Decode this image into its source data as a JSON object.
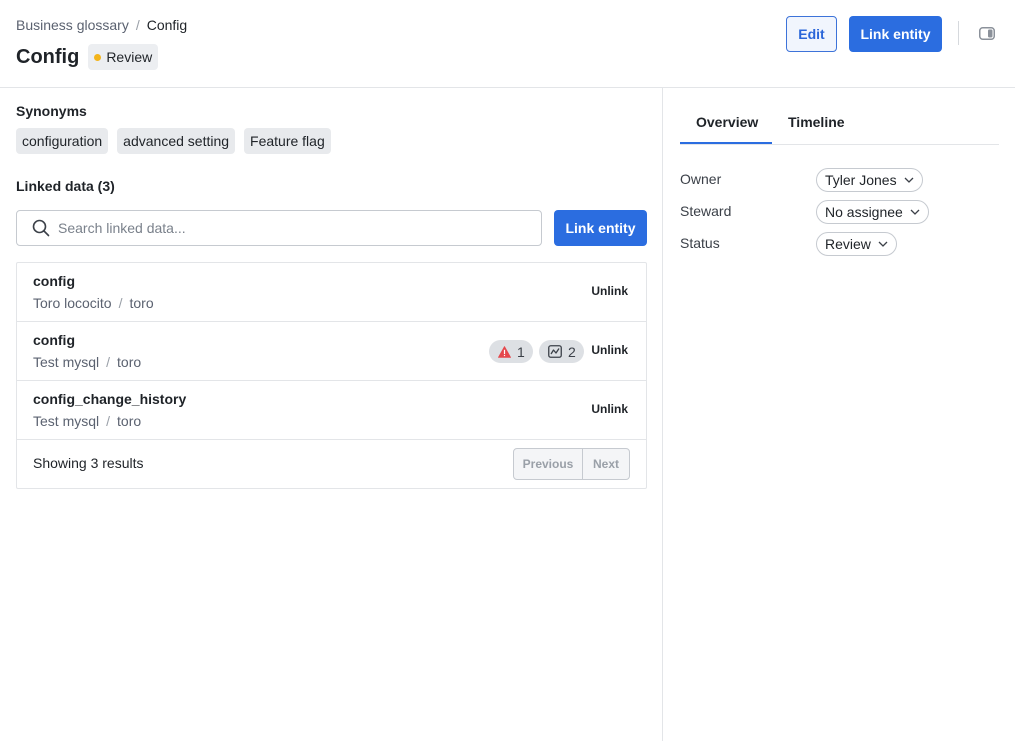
{
  "breadcrumb": {
    "parent": "Business glossary",
    "separator": "/",
    "current": "Config"
  },
  "header": {
    "title": "Config",
    "status": "Review",
    "status_color": "#f3b41b",
    "edit_label": "Edit",
    "link_entity_label": "Link entity"
  },
  "synonyms": {
    "title": "Synonyms",
    "items": [
      "configuration",
      "advanced setting",
      "Feature flag"
    ]
  },
  "linked": {
    "title": "Linked data (3)",
    "search_placeholder": "Search linked data...",
    "link_entity_label": "Link entity",
    "rows": [
      {
        "name": "config",
        "source": "Toro lococito",
        "schema": "toro",
        "unlink": "Unlink"
      },
      {
        "name": "config",
        "source": "Test mysql",
        "schema": "toro",
        "unlink": "Unlink",
        "alert_count": "1",
        "quality_count": "2"
      },
      {
        "name": "config_change_history",
        "source": "Test mysql",
        "schema": "toro",
        "unlink": "Unlink"
      }
    ],
    "results_text": "Showing 3 results",
    "previous": "Previous",
    "next": "Next"
  },
  "sidebar": {
    "tabs": [
      "Overview",
      "Timeline"
    ],
    "active_tab": "Overview",
    "properties": [
      {
        "label": "Owner",
        "value": "Tyler Jones"
      },
      {
        "label": "Steward",
        "value": "No assignee"
      },
      {
        "label": "Status",
        "value": "Review"
      }
    ]
  },
  "colors": {
    "accent": "#2b6de0",
    "alert": "#e5484d",
    "review_dot": "#f3b41b"
  },
  "icons": {
    "search": "search-icon",
    "alert": "warning-triangle-icon",
    "quality": "data-quality-icon",
    "chevron": "chevron-down-icon",
    "panel": "panel-toggle-icon"
  }
}
